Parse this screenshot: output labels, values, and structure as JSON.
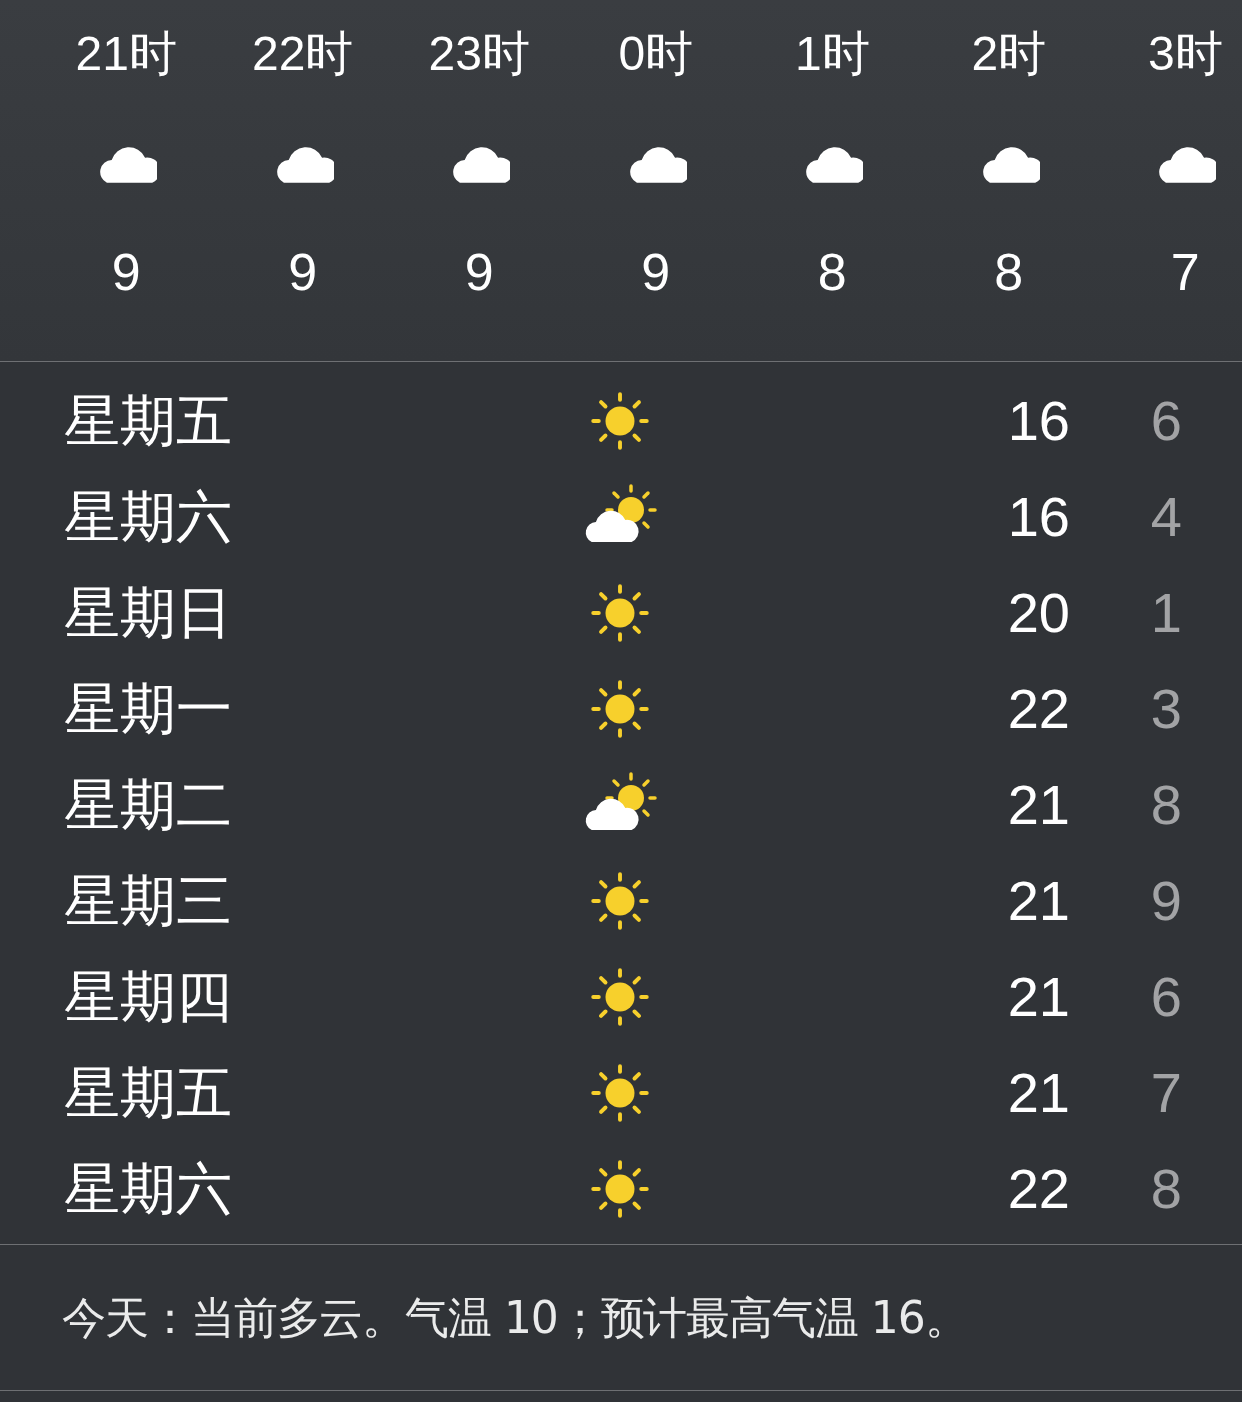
{
  "hourly": [
    {
      "time": "21时",
      "kind": "cloudy",
      "temp": "9"
    },
    {
      "time": "22时",
      "kind": "cloudy",
      "temp": "9"
    },
    {
      "time": "23时",
      "kind": "cloudy",
      "temp": "9"
    },
    {
      "time": "0时",
      "kind": "cloudy",
      "temp": "9"
    },
    {
      "time": "1时",
      "kind": "cloudy",
      "temp": "8"
    },
    {
      "time": "2时",
      "kind": "cloudy",
      "temp": "8"
    },
    {
      "time": "3时",
      "kind": "cloudy",
      "temp": "7"
    }
  ],
  "daily": [
    {
      "day": "星期五",
      "kind": "sunny",
      "high": "16",
      "low": "6"
    },
    {
      "day": "星期六",
      "kind": "partly_cloudy",
      "high": "16",
      "low": "4"
    },
    {
      "day": "星期日",
      "kind": "sunny",
      "high": "20",
      "low": "1"
    },
    {
      "day": "星期一",
      "kind": "sunny",
      "high": "22",
      "low": "3"
    },
    {
      "day": "星期二",
      "kind": "partly_cloudy",
      "high": "21",
      "low": "8"
    },
    {
      "day": "星期三",
      "kind": "sunny",
      "high": "21",
      "low": "9"
    },
    {
      "day": "星期四",
      "kind": "sunny",
      "high": "21",
      "low": "6"
    },
    {
      "day": "星期五",
      "kind": "sunny",
      "high": "21",
      "low": "7"
    },
    {
      "day": "星期六",
      "kind": "sunny",
      "high": "22",
      "low": "8"
    }
  ],
  "summary": "今天：当前多云。气温 10；预计最高气温 16。"
}
